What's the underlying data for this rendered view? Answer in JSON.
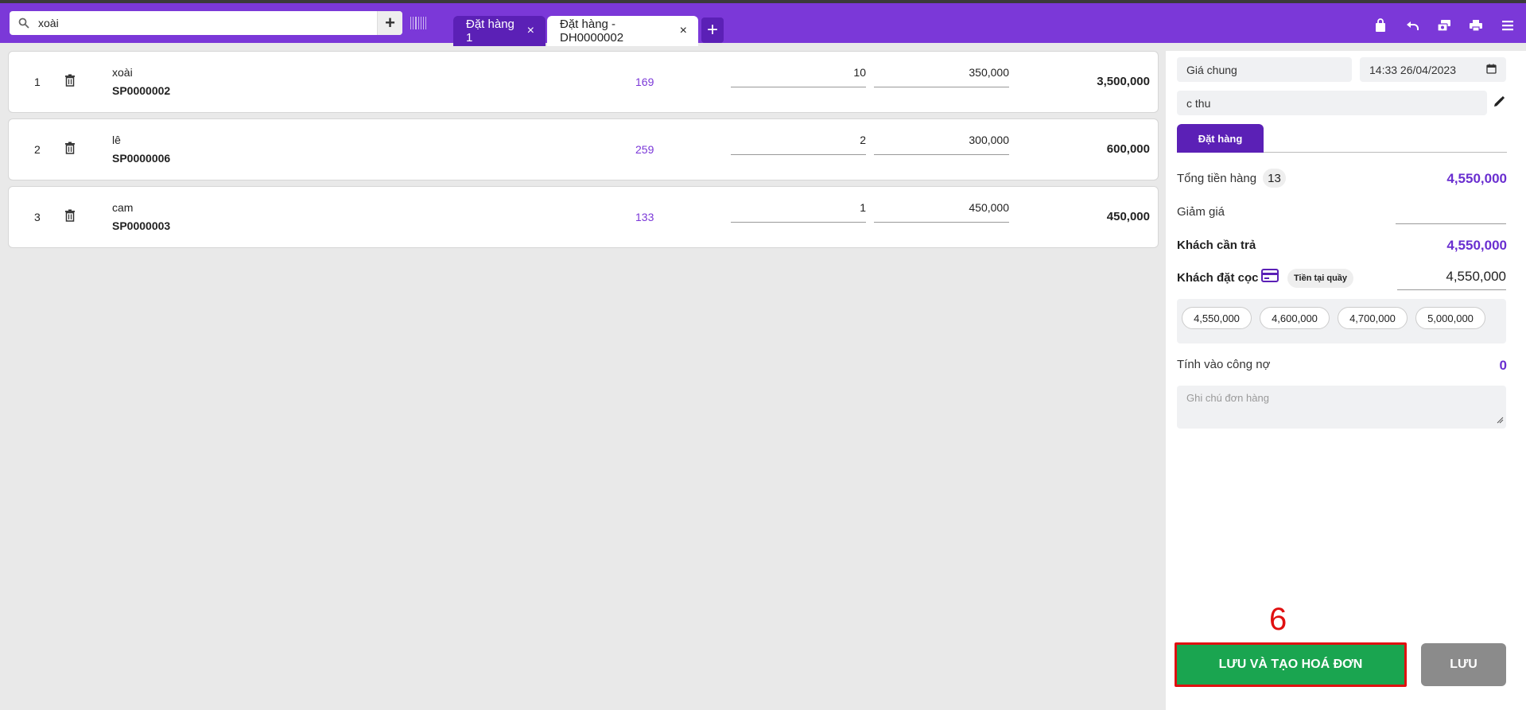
{
  "search": {
    "value": "xoài",
    "add_label": "+"
  },
  "tabs": [
    {
      "label": "Đặt hàng 1",
      "close": "×"
    },
    {
      "label": "Đặt hàng - DH0000002",
      "close": "×"
    }
  ],
  "tab_add": "+",
  "items": [
    {
      "index": "1",
      "name": "xoài",
      "code": "SP0000002",
      "stock": "169",
      "qty": "10",
      "price": "350,000",
      "total": "3,500,000"
    },
    {
      "index": "2",
      "name": "lê",
      "code": "SP0000006",
      "stock": "259",
      "qty": "2",
      "price": "300,000",
      "total": "600,000"
    },
    {
      "index": "3",
      "name": "cam",
      "code": "SP0000003",
      "stock": "133",
      "qty": "1",
      "price": "450,000",
      "total": "450,000"
    }
  ],
  "panel": {
    "price_list": "Giá chung",
    "datetime": "14:33 26/04/2023",
    "customer": "c thu",
    "sub_tab": "Đặt hàng",
    "subtotal_label": "Tổng tiền hàng",
    "subtotal_count": "13",
    "subtotal_value": "4,550,000",
    "discount_label": "Giảm giá",
    "discount_value": "",
    "payable_label": "Khách cần trả",
    "payable_value": "4,550,000",
    "deposit_label": "Khách đặt cọc",
    "deposit_method": "Tiền tại quầy",
    "deposit_value": "4,550,000",
    "quick_amounts": [
      "4,550,000",
      "4,600,000",
      "4,700,000",
      "5,000,000"
    ],
    "debt_label": "Tính vào công nợ",
    "debt_value": "0",
    "notes_placeholder": "Ghi chú đơn hàng",
    "save_create_label": "LƯU VÀ TẠO HOÁ ĐƠN",
    "save_label": "LƯU"
  },
  "step_marker": "6",
  "colors": {
    "brand": "#7b38d8",
    "brand_dark": "#5b20b6",
    "success": "#1aa550",
    "highlight": "#e01010"
  }
}
